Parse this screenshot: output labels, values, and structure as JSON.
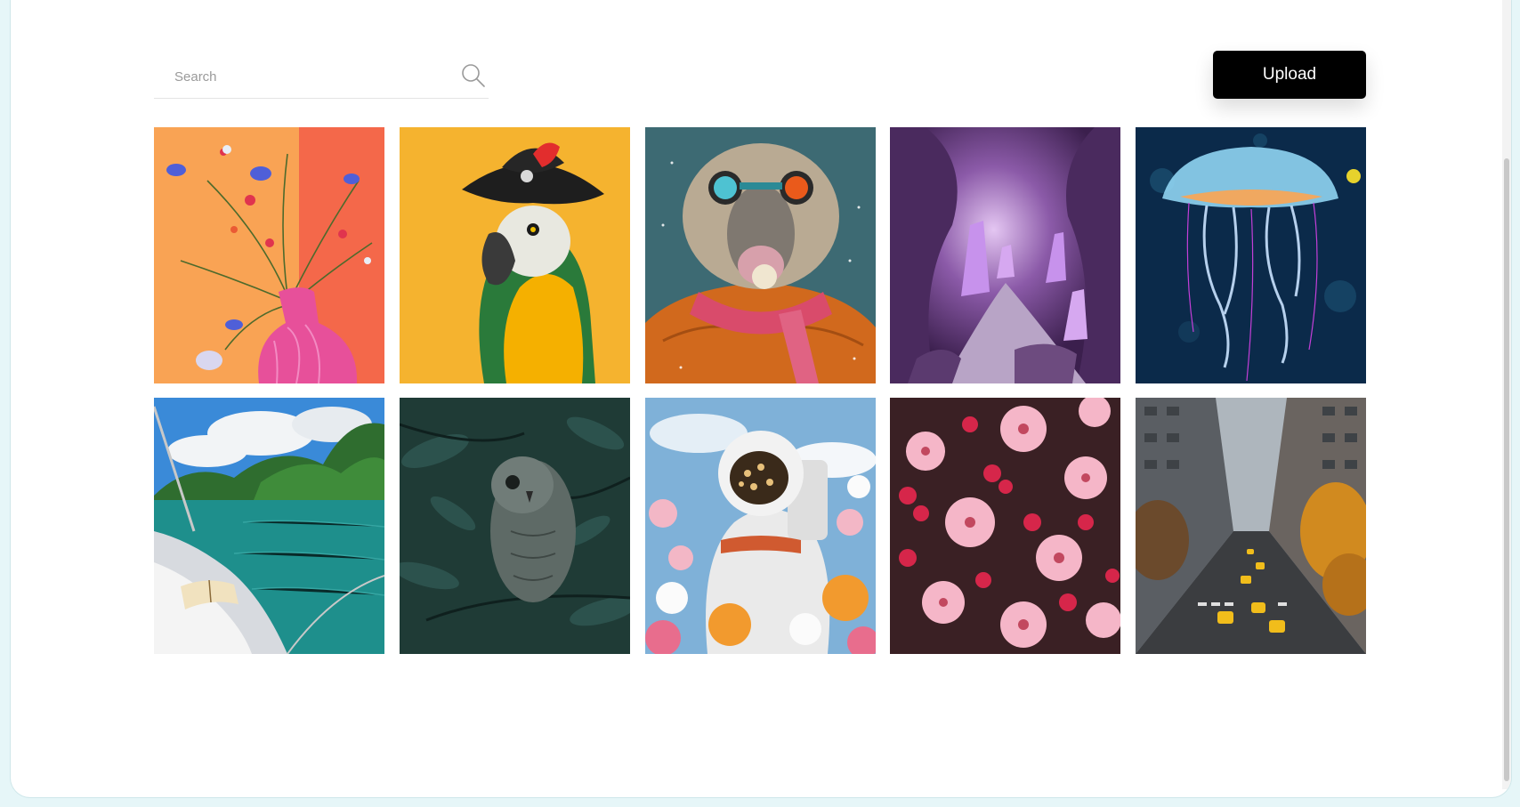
{
  "search": {
    "placeholder": "Search"
  },
  "toolbar": {
    "upload_label": "Upload"
  },
  "colors": {
    "button_bg": "#000000",
    "button_text": "#ffffff"
  },
  "gallery": {
    "images": [
      {
        "icon": "flower-vase-illustration"
      },
      {
        "icon": "parrot-pirate-hat"
      },
      {
        "icon": "sheep-with-goggles"
      },
      {
        "icon": "purple-crystal-cave"
      },
      {
        "icon": "glowing-jellyfish"
      },
      {
        "icon": "sailboat-book-lagoon"
      },
      {
        "icon": "owl-in-forest"
      },
      {
        "icon": "astronaut-flowers"
      },
      {
        "icon": "pink-blossoms"
      },
      {
        "icon": "city-street-taxis"
      }
    ]
  }
}
